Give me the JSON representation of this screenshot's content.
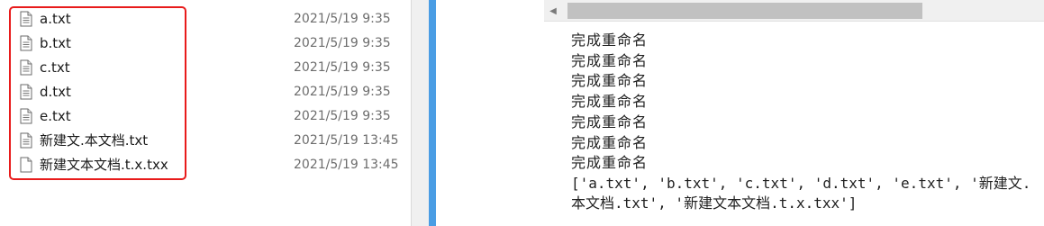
{
  "explorer": {
    "files": [
      {
        "name": "a.txt",
        "modified": "2021/5/19 9:35",
        "icon": "text-file-icon"
      },
      {
        "name": "b.txt",
        "modified": "2021/5/19 9:35",
        "icon": "text-file-icon"
      },
      {
        "name": "c.txt",
        "modified": "2021/5/19 9:35",
        "icon": "text-file-icon"
      },
      {
        "name": "d.txt",
        "modified": "2021/5/19 9:35",
        "icon": "text-file-icon"
      },
      {
        "name": "e.txt",
        "modified": "2021/5/19 9:35",
        "icon": "text-file-icon"
      },
      {
        "name": "新建文.本文档.txt",
        "modified": "2021/5/19 13:45",
        "icon": "text-file-icon"
      },
      {
        "name": "新建文本文档.t.x.txx",
        "modified": "2021/5/19 13:45",
        "icon": "blank-file-icon"
      }
    ],
    "selection_color": "#e81b1b"
  },
  "console": {
    "scroll_left_glyph": "◀",
    "output_lines": [
      "完成重命名",
      "完成重命名",
      "完成重命名",
      "完成重命名",
      "完成重命名",
      "完成重命名",
      "完成重命名"
    ],
    "result_list": "['a.txt', 'b.txt', 'c.txt', 'd.txt', 'e.txt', '新建文.本文档.txt', '新建文本文档.t.x.txx']"
  },
  "colors": {
    "divider_accent": "#4a9de4",
    "scrollbar_track": "#f0f0f0",
    "scrollbar_thumb": "#c1c1c1"
  }
}
